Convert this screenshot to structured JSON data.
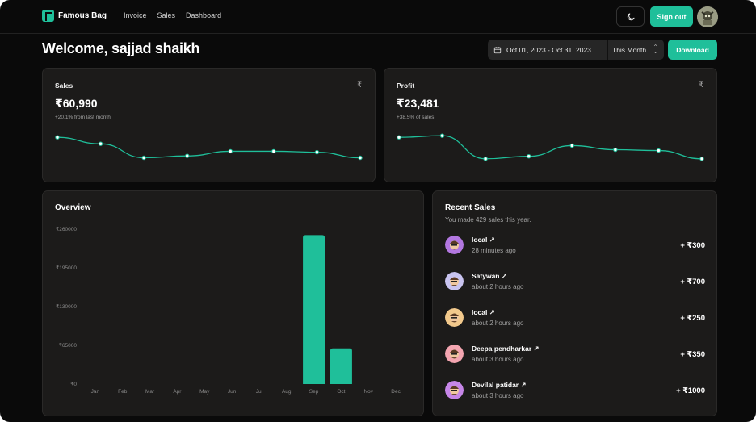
{
  "app": {
    "name": "Famous Bag"
  },
  "nav": {
    "links": [
      "Invoice",
      "Sales",
      "Dashboard"
    ],
    "signout_label": "Sign out"
  },
  "header": {
    "welcome": "Welcome, sajjad shaikh",
    "date_range": "Oct 01, 2023 - Oct 31, 2023",
    "period": "This Month",
    "download_label": "Download"
  },
  "stats": {
    "sales": {
      "title": "Sales",
      "value": "₹60,990",
      "sub": "+20.1% from last month",
      "icon": "₹"
    },
    "profit": {
      "title": "Profit",
      "value": "₹23,481",
      "sub": "+38.5% of sales",
      "icon": "₹"
    }
  },
  "overview": {
    "title": "Overview"
  },
  "recent_sales": {
    "title": "Recent Sales",
    "subtitle": "You made 429 sales this year.",
    "items": [
      {
        "name": "local ↗",
        "time": "28 minutes ago",
        "amount": "+ ₹300",
        "avatar_color": "#b277e0"
      },
      {
        "name": "Satywan ↗",
        "time": "about 2 hours ago",
        "amount": "+ ₹700",
        "avatar_color": "#c9c4f0"
      },
      {
        "name": "local ↗",
        "time": "about 2 hours ago",
        "amount": "+ ₹250",
        "avatar_color": "#f2c98c"
      },
      {
        "name": "Deepa pendharkar ↗",
        "time": "about 3 hours ago",
        "amount": "+ ₹350",
        "avatar_color": "#f3a5b0"
      },
      {
        "name": "Devilal patidar ↗",
        "time": "about 3 hours ago",
        "amount": "+ ₹1000",
        "avatar_color": "#c686e8"
      }
    ]
  },
  "chart_data": [
    {
      "type": "line",
      "series": [
        {
          "values": [
            62,
            55,
            40,
            42,
            47,
            47,
            46,
            40
          ]
        }
      ],
      "ylim": [
        30,
        70
      ],
      "color": "#1fbf9a"
    },
    {
      "type": "line",
      "series": [
        {
          "values": [
            56,
            58,
            30,
            33,
            46,
            41,
            40,
            30
          ]
        }
      ],
      "ylim": [
        20,
        65
      ],
      "color": "#1fbf9a"
    },
    {
      "type": "bar",
      "title": "Overview",
      "categories": [
        "Jan",
        "Feb",
        "Mar",
        "Apr",
        "May",
        "Jun",
        "Jul",
        "Aug",
        "Sep",
        "Oct",
        "Nov",
        "Dec"
      ],
      "values": [
        0,
        0,
        0,
        0,
        0,
        0,
        0,
        0,
        250000,
        60000,
        0,
        0
      ],
      "yticks": [
        "₹0",
        "₹65000",
        "₹130000",
        "₹195000",
        "₹260000"
      ],
      "ylim": [
        0,
        260000
      ],
      "color": "#1fbf9a"
    }
  ]
}
